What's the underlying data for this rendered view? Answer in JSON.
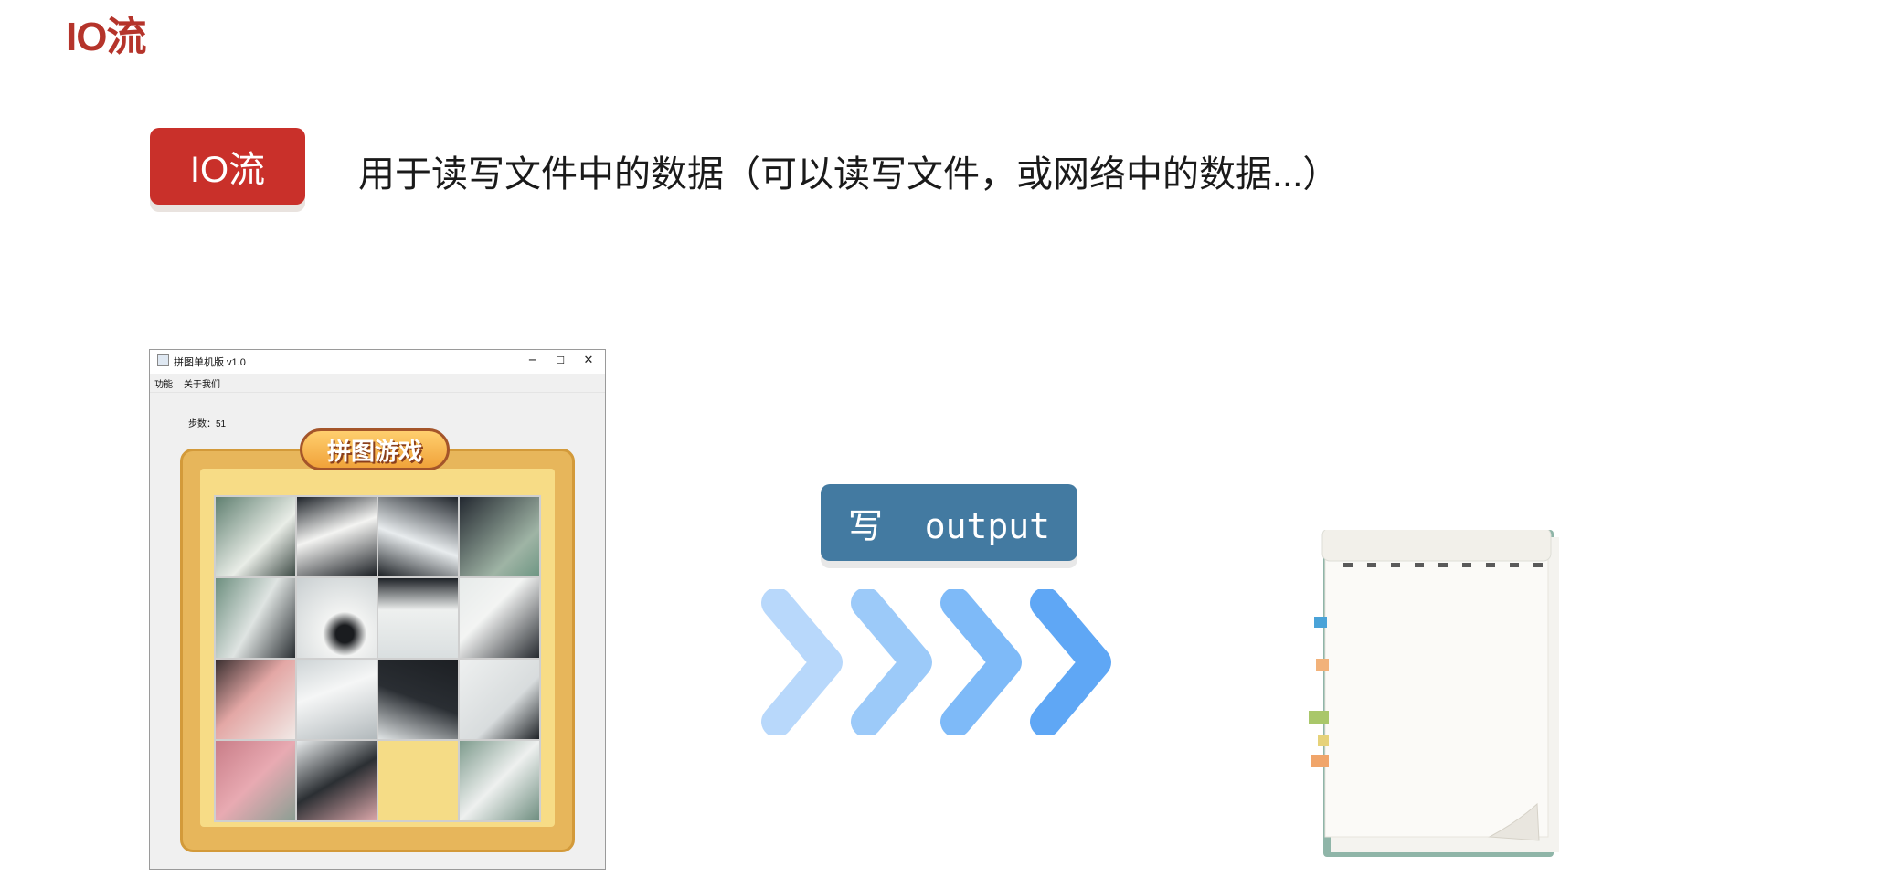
{
  "slide": {
    "title": "IO流",
    "badge": "IO流",
    "definition": "用于读写文件中的数据（可以读写文件，或网络中的数据...）"
  },
  "game_window": {
    "title": "拼图单机版 v1.0",
    "controls": {
      "minimize": "−",
      "maximize": "☐",
      "close": "✕"
    },
    "menu": [
      "功能",
      "关于我们"
    ],
    "step_count": "步数：51",
    "logo": "拼图游戏",
    "grid": {
      "rows": 4,
      "cols": 4,
      "empty_tile": {
        "row": 4,
        "col": 3
      }
    }
  },
  "output_label": "写  output",
  "colors": {
    "title_red": "#b5342b",
    "badge_red": "#c9302a",
    "output_blue": "#437aa1",
    "arrow_blue": [
      "#b8d8fb",
      "#9ccaf9",
      "#7ebaf8",
      "#5fa7f5"
    ]
  },
  "icons": {
    "arrows": "chevron-right-icon",
    "notebook": "notebook-icon",
    "app": "java-app-icon"
  }
}
